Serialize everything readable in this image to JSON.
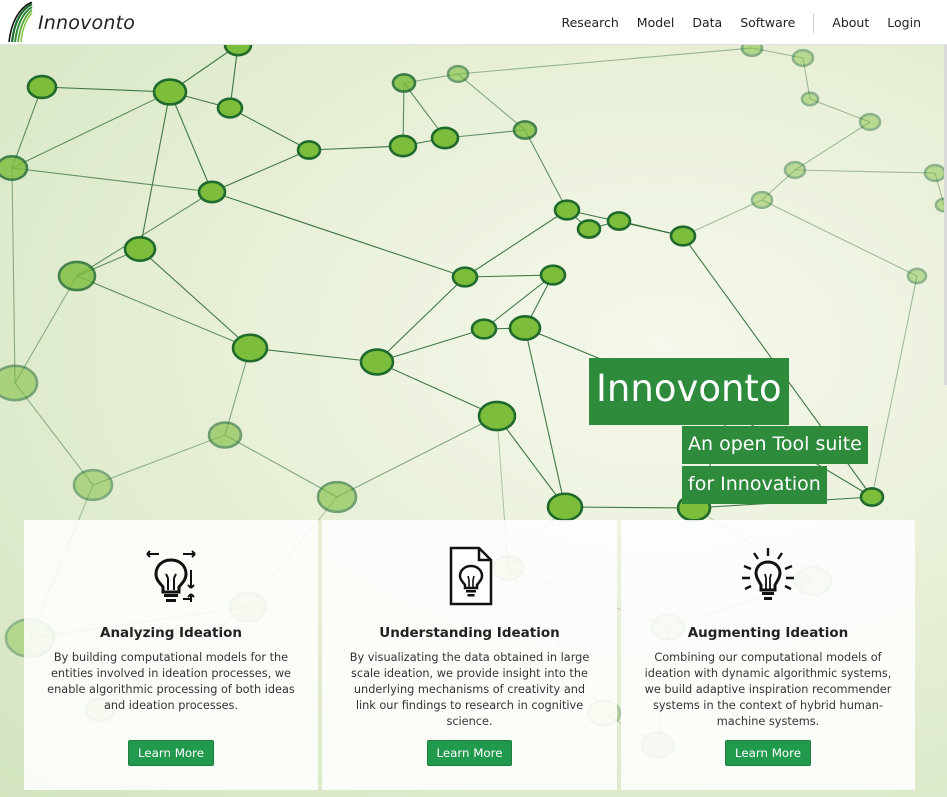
{
  "brand": {
    "name": "Innovonto",
    "logo_icon": "swoosh-logo-icon"
  },
  "nav": {
    "items": [
      "Research",
      "Model",
      "Data",
      "Software"
    ],
    "secondary": [
      "About",
      "Login"
    ]
  },
  "hero": {
    "title": "Innovonto",
    "tagline_1": "An open Tool suite",
    "tagline_2": "for Innovation",
    "background": "green-network-graph"
  },
  "cards": [
    {
      "icon": "lightbulb-arrows-icon",
      "title": "Analyzing Ideation",
      "text": "By building computational models for the entities involved in ideation processes, we enable algorithmic processing of both ideas and ideation processes.",
      "button": "Learn More"
    },
    {
      "icon": "lightbulb-document-icon",
      "title": "Understanding Ideation",
      "text": "By visualizating the data obtained in large scale ideation, we provide insight into the underlying mechanisms of creativity and link our findings to research in cognitive science.",
      "button": "Learn More"
    },
    {
      "icon": "lightbulb-shining-icon",
      "title": "Augmenting Ideation",
      "text": "Combining our computational models of ideation with dynamic algorithmic systems, we build adaptive inspiration recommender systems in the context of hybrid human-machine systems.",
      "button": "Learn More"
    }
  ],
  "colors": {
    "accent": "#2e8b3c",
    "button": "#229a4e",
    "node": "#7cbd3b",
    "edge": "#2f6b33"
  }
}
